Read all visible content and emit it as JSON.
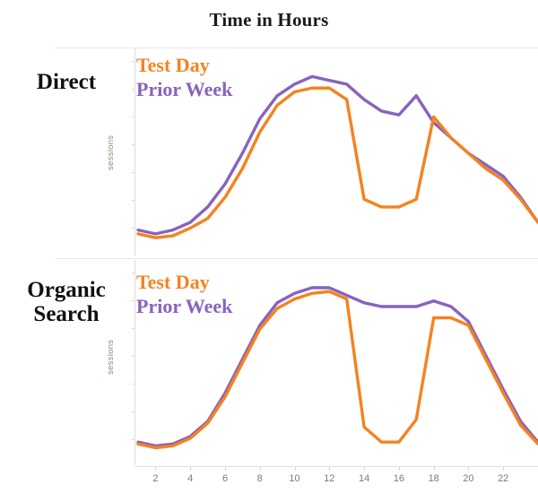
{
  "title": "Time in Hours",
  "legend": {
    "test_day": "Test Day",
    "prior_week": "Prior Week"
  },
  "colors": {
    "test_day": "#F5821F",
    "prior_week": "#8763BE",
    "axis": "#dcdcdc",
    "tick_label": "#7a7a7a",
    "axis_title": "#8d8a72",
    "title": "#1a1a1a"
  },
  "panels": [
    {
      "label": "Direct",
      "axis_title": "sessions"
    },
    {
      "label": "Organic\nSearch",
      "axis_title": "sessions"
    }
  ],
  "panel_labels": {
    "direct": "Direct",
    "organic_line1": "Organic",
    "organic_line2": "Search"
  },
  "axis_title_text": "sessions",
  "x_axis": {
    "tick_labels": [
      "2",
      "4",
      "6",
      "8",
      "10",
      "12",
      "14",
      "16",
      "18",
      "20",
      "22"
    ],
    "tick_values": [
      2,
      4,
      6,
      8,
      10,
      12,
      14,
      16,
      18,
      20,
      22
    ],
    "range": [
      1,
      24
    ]
  },
  "chart_data": [
    {
      "type": "line",
      "title": "Direct",
      "xlabel": "Time in Hours",
      "ylabel": "sessions",
      "x": [
        1,
        2,
        3,
        4,
        5,
        6,
        7,
        8,
        9,
        10,
        11,
        12,
        13,
        14,
        15,
        16,
        17,
        18,
        19,
        20,
        21,
        22,
        23,
        24
      ],
      "xlim": [
        1,
        24
      ],
      "ylim": [
        0,
        100
      ],
      "grid": false,
      "legend_position": "top-left",
      "series": [
        {
          "name": "Test Day",
          "color": "#F5821F",
          "values": [
            8,
            6,
            7,
            11,
            16,
            27,
            42,
            61,
            75,
            82,
            84,
            84,
            78,
            26,
            22,
            22,
            26,
            69,
            58,
            50,
            42,
            36,
            26,
            14
          ]
        },
        {
          "name": "Prior Week",
          "color": "#8763BE",
          "values": [
            10,
            8,
            10,
            14,
            22,
            34,
            50,
            68,
            80,
            86,
            90,
            88,
            86,
            78,
            72,
            70,
            80,
            66,
            58,
            50,
            44,
            38,
            27,
            14
          ]
        }
      ]
    },
    {
      "type": "line",
      "title": "Organic Search",
      "xlabel": "Time in Hours",
      "ylabel": "sessions",
      "x": [
        1,
        2,
        3,
        4,
        5,
        6,
        7,
        8,
        9,
        10,
        11,
        12,
        13,
        14,
        15,
        16,
        17,
        18,
        19,
        20,
        21,
        22,
        23,
        24
      ],
      "xlim": [
        1,
        24
      ],
      "ylim": [
        0,
        100
      ],
      "grid": false,
      "legend_position": "top-left",
      "series": [
        {
          "name": "Test Day",
          "color": "#F5821F",
          "values": [
            7,
            5,
            6,
            10,
            18,
            32,
            50,
            68,
            79,
            84,
            87,
            88,
            84,
            16,
            8,
            8,
            20,
            74,
            74,
            70,
            52,
            34,
            17,
            7
          ]
        },
        {
          "name": "Prior Week",
          "color": "#8763BE",
          "values": [
            8,
            6,
            7,
            11,
            19,
            34,
            52,
            70,
            82,
            87,
            90,
            90,
            86,
            82,
            80,
            80,
            80,
            83,
            80,
            72,
            54,
            36,
            19,
            8
          ]
        }
      ]
    }
  ]
}
